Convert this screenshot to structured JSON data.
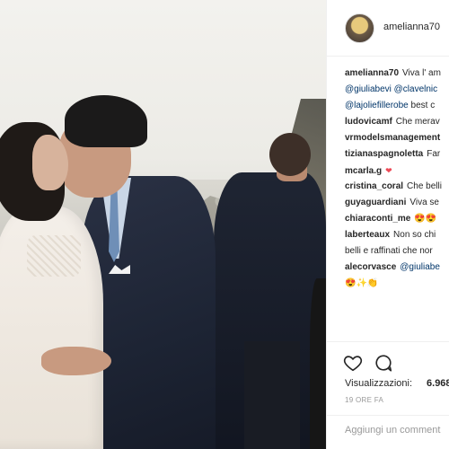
{
  "post": {
    "author": "amelianna70",
    "views_label": "Visualizzazioni:",
    "views_value": "6.968",
    "time_ago": "19 ORE FA",
    "add_comment_placeholder": "Aggiungi un comment"
  },
  "caption": {
    "user": "amelianna70",
    "line1": "Viva l' am",
    "line2_mentions": [
      "@giuliabevi",
      "@clavelnic"
    ],
    "line3_mention": "@lajoliefillerobe",
    "line3_text": "best c"
  },
  "comments": [
    {
      "user": "ludovicamf",
      "text": "Che merav"
    },
    {
      "user": "vrmodelsmanagement",
      "text": ""
    },
    {
      "user": "tizianaspagnoletta",
      "text": "Far"
    },
    {
      "user": "mcarla.g",
      "text": "❤"
    },
    {
      "user": "cristina_coral",
      "text": "Che belli"
    },
    {
      "user": "guyaguardiani",
      "text": "Viva se"
    },
    {
      "user": "chiaraconti_me",
      "text": "😍😍"
    },
    {
      "user": "laberteaux",
      "text": "Non so chi"
    },
    {
      "user": "",
      "text": "belli e raffinati che nor"
    },
    {
      "user": "alecorvasce",
      "text": "@giuliabe"
    },
    {
      "user": "",
      "text": "😍✨👏"
    }
  ],
  "colors": {
    "text": "#262626",
    "mention": "#003569",
    "muted": "#999999",
    "heart": "#ed4956",
    "border": "#efefef"
  },
  "icons": [
    "heart-icon",
    "comment-icon"
  ]
}
